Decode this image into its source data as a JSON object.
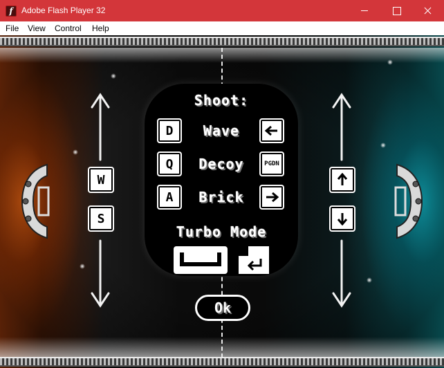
{
  "window": {
    "title": "Adobe Flash Player 32",
    "app_icon_glyph": "f",
    "controls": [
      "minimize",
      "maximize",
      "close"
    ]
  },
  "menu": {
    "items": [
      "File",
      "View",
      "Control",
      "Help"
    ]
  },
  "game": {
    "left_player": {
      "color": "#ff6a1a",
      "up_key": "W",
      "down_key": "S"
    },
    "right_player": {
      "color": "#1ad8e8",
      "up_key": "arrow-up",
      "down_key": "arrow-down"
    },
    "controls_panel": {
      "shoot_label": "Shoot:",
      "weapons": [
        {
          "left_key": "D",
          "name": "Wave",
          "right_key": "arrow-left"
        },
        {
          "left_key": "Q",
          "name": "Decoy",
          "right_key": "PGDN"
        },
        {
          "left_key": "A",
          "name": "Brick",
          "right_key": "arrow-right"
        }
      ],
      "turbo_label": "Turbo Mode",
      "turbo_left_key": "space-bar",
      "turbo_right_key": "enter"
    },
    "ok_label": "Ok"
  }
}
